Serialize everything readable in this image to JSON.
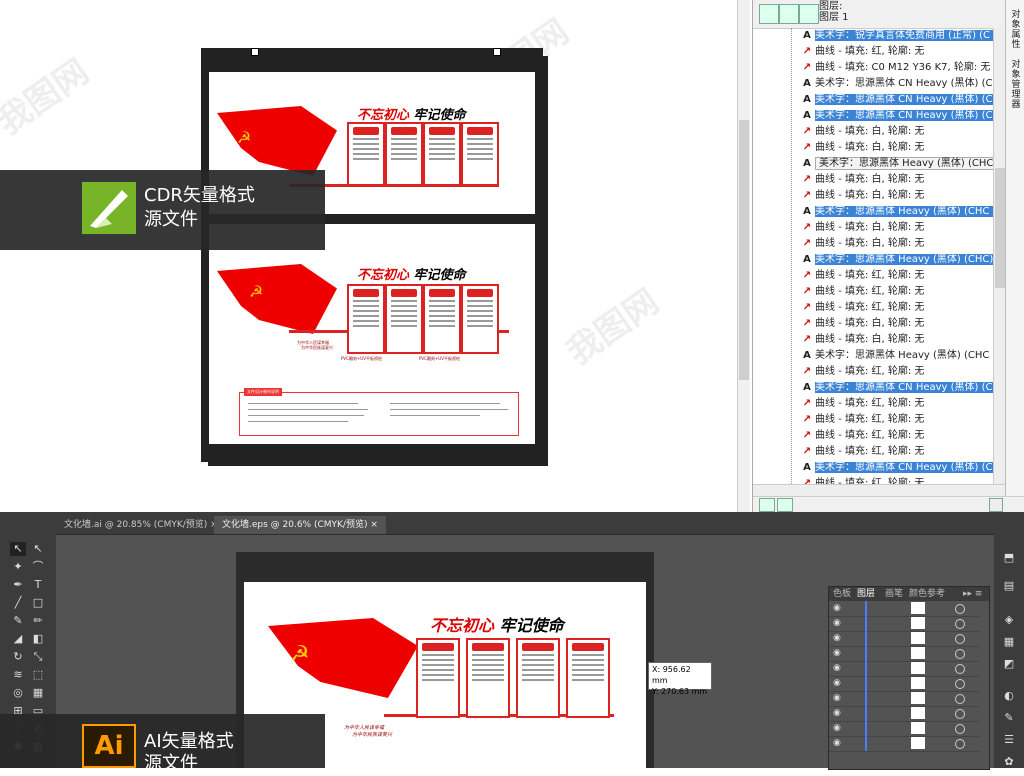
{
  "upper": {
    "badge_title": [
      "CDR矢量格式",
      "源文件"
    ],
    "design": {
      "slogan_red": "不忘初心",
      "slogan_black": "牢记使命",
      "panel_titles": [
        "",
        "",
        "",
        ""
      ],
      "sheet2_captions": [
        "PVC雕刻+UV平板喷绘",
        "PVC雕刻+UV平板喷绘"
      ],
      "sub_lines": [
        "为中华人民谋幸福",
        "为中华民族谋复兴"
      ],
      "info_title": "文件设计制作说明"
    }
  },
  "object_manager": {
    "layer_label": [
      "图层:",
      "图层 1"
    ],
    "side_tabs": [
      "对象属性",
      "对象管理器"
    ],
    "rows": [
      {
        "icon": "A",
        "text": "美术字：锐字真言体免费商用 (正常) (C",
        "selected": true
      },
      {
        "icon": "curve",
        "text": "曲线 - 填充: 红, 轮廓: 无",
        "selected": false
      },
      {
        "icon": "curve",
        "text": "曲线 - 填充: C0 M12 Y36 K7, 轮廓: 无",
        "selected": false
      },
      {
        "icon": "A",
        "text": "美术字：思源黑体 CN Heavy (黑体) (C",
        "selected": false
      },
      {
        "icon": "A",
        "text": "美术字：思源黑体 CN Heavy (黑体) (C",
        "selected": true
      },
      {
        "icon": "A",
        "text": "美术字：思源黑体 CN Heavy (黑体) (C",
        "selected": true
      },
      {
        "icon": "curve",
        "text": "曲线 - 填充: 白, 轮廓: 无",
        "selected": false
      },
      {
        "icon": "curve",
        "text": "曲线 - 填充: 白, 轮廓: 无",
        "selected": false
      },
      {
        "icon": "A",
        "text": "美术字：思源黑体 Heavy (黑体) (CHC) - 填充:",
        "selected": false,
        "tip": true
      },
      {
        "icon": "curve",
        "text": "曲线 - 填充: 白, 轮廓: 无",
        "selected": false
      },
      {
        "icon": "curve",
        "text": "曲线 - 填充: 白, 轮廓: 无",
        "selected": false
      },
      {
        "icon": "A",
        "text": "美术字：思源黑体 Heavy (黑体) (CHC",
        "selected": true
      },
      {
        "icon": "curve",
        "text": "曲线 - 填充: 白, 轮廓: 无",
        "selected": false
      },
      {
        "icon": "curve",
        "text": "曲线 - 填充: 白, 轮廓: 无",
        "selected": false
      },
      {
        "icon": "A",
        "text": "美术字：思源黑体 Heavy (黑体) (CHC)",
        "selected": true
      },
      {
        "icon": "curve",
        "text": "曲线 - 填充: 红, 轮廓: 无",
        "selected": false
      },
      {
        "icon": "curve",
        "text": "曲线 - 填充: 红, 轮廓: 无",
        "selected": false
      },
      {
        "icon": "curve",
        "text": "曲线 - 填充: 红, 轮廓: 无",
        "selected": false
      },
      {
        "icon": "curve",
        "text": "曲线 - 填充: 白, 轮廓: 无",
        "selected": false
      },
      {
        "icon": "curve",
        "text": "曲线 - 填充: 白, 轮廓: 无",
        "selected": false
      },
      {
        "icon": "A",
        "text": "美术字：思源黑体 Heavy (黑体) (CHC",
        "selected": false
      },
      {
        "icon": "curve",
        "text": "曲线 - 填充: 红, 轮廓: 无",
        "selected": false
      },
      {
        "icon": "A",
        "text": "美术字：思源黑体 CN Heavy (黑体) (C",
        "selected": true
      },
      {
        "icon": "curve",
        "text": "曲线 - 填充: 红, 轮廓: 无",
        "selected": false
      },
      {
        "icon": "curve",
        "text": "曲线 - 填充: 红, 轮廓: 无",
        "selected": false
      },
      {
        "icon": "curve",
        "text": "曲线 - 填充: 红, 轮廓: 无",
        "selected": false
      },
      {
        "icon": "curve",
        "text": "曲线 - 填充: 红, 轮廓: 无",
        "selected": false
      },
      {
        "icon": "A",
        "text": "美术字：思源黑体 CN Heavy (黑体) (C",
        "selected": true
      },
      {
        "icon": "curve",
        "text": "曲线 - 填充: 红, 轮廓: 无",
        "selected": false
      }
    ]
  },
  "illustrator": {
    "tabs": [
      "文化墙.ai @ 20.85% (CMYK/预览)",
      "文化墙.eps @ 20.6% (CMYK/预览)"
    ],
    "tab_close": "×",
    "badge_logo": "Ai",
    "badge_title": [
      "AI矢量格式",
      "源文件"
    ],
    "coord_x": "X: 956.62 mm",
    "coord_y": "Y: 270.63 mm",
    "panel_tabs": [
      "色板",
      "图层",
      "画笔",
      "颜色参考"
    ],
    "panel_active": "图层",
    "layer_count": 10
  },
  "colors": {
    "selection": "#3a83d6",
    "accent_red": "#d22222",
    "ai_bg": "#535353",
    "ai_logo": "#ff9a00",
    "cdr_logo": "#78b428"
  }
}
